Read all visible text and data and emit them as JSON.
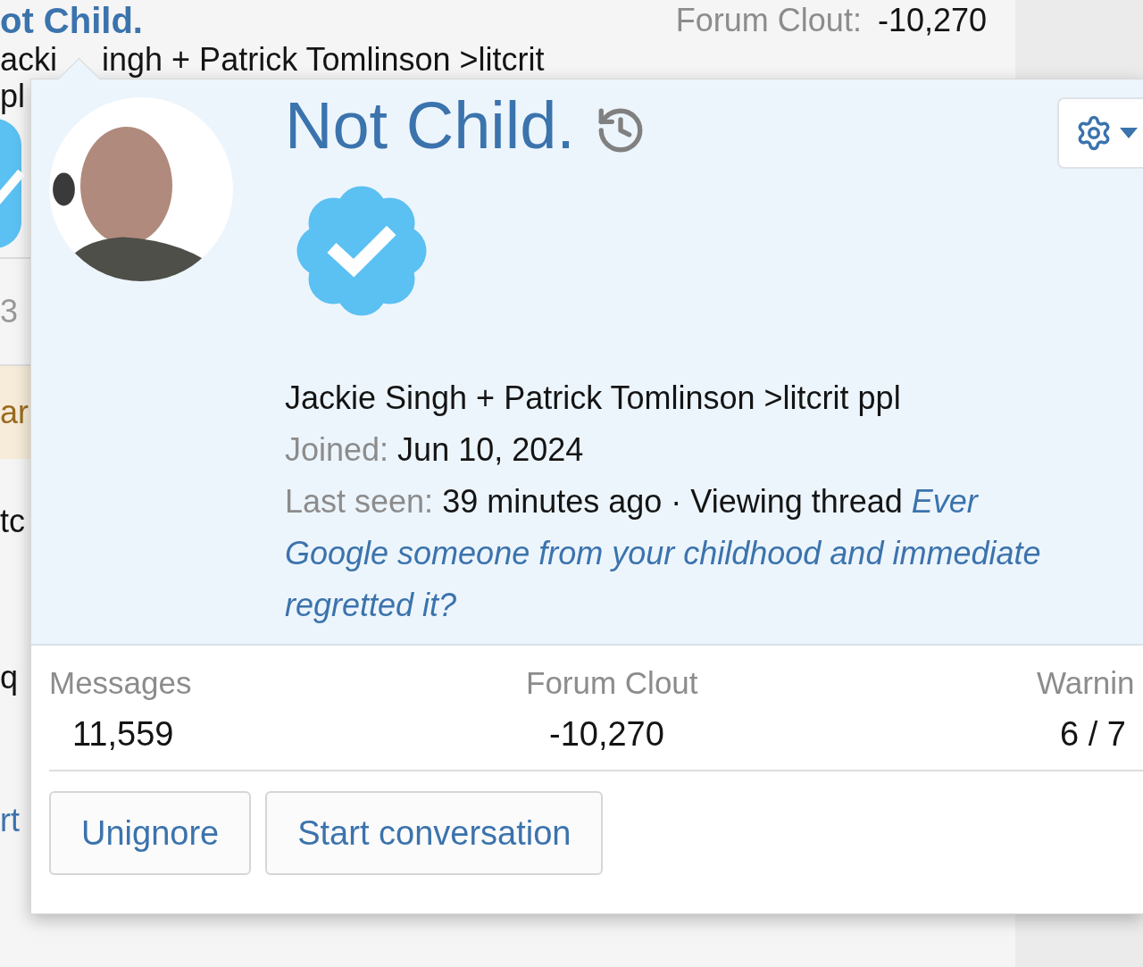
{
  "background": {
    "username": "ot Child.",
    "clout_label": "Forum Clout:",
    "clout_value": "-10,270",
    "subtitle_parts": [
      "acki",
      "ingh + Patrick Tomlinson >litcrit"
    ],
    "fragments": [
      {
        "kind": "plain",
        "text": "pl"
      },
      {
        "kind": "badge"
      },
      {
        "kind": "muted",
        "text": "3"
      },
      {
        "kind": "highlight",
        "text": "ar"
      },
      {
        "kind": "plain",
        "text": "tc"
      },
      {
        "kind": "plain",
        "text": "q"
      },
      {
        "kind": "link",
        "text": "rt"
      }
    ]
  },
  "popup": {
    "name": "Not Child.",
    "verified": true,
    "title": "Jackie Singh + Patrick Tomlinson >litcrit ppl",
    "joined_label": "Joined:",
    "joined": "Jun 10, 2024",
    "last_seen_label": "Last seen:",
    "last_seen": "39 minutes ago · Viewing thread",
    "thread_link_lines": [
      "Ever",
      "Google someone from your childhood and immediate",
      "regretted it?"
    ],
    "stats": [
      {
        "label": "Messages",
        "value": "11,559"
      },
      {
        "label": "Forum Clout",
        "value": "-10,270"
      },
      {
        "label": "Warnin",
        "value": "6 / 7"
      }
    ],
    "buttons": [
      "Unignore",
      "Start conversation"
    ]
  }
}
